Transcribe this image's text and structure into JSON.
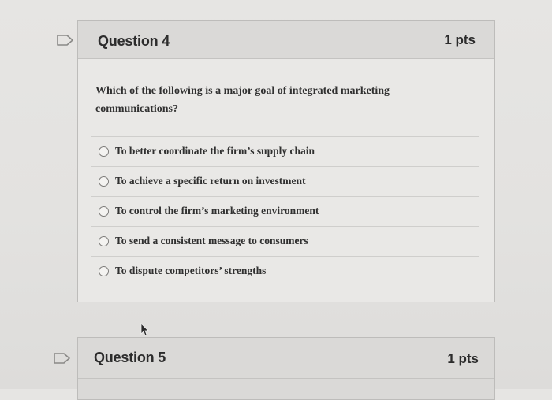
{
  "questions": [
    {
      "title": "Question 4",
      "points": "1 pts",
      "text": "Which of the following is a major goal of integrated marketing communications?",
      "answers": [
        {
          "label": "To better coordinate the firm’s supply chain"
        },
        {
          "label": "To achieve a specific return on investment"
        },
        {
          "label": "To control the firm’s marketing environment"
        },
        {
          "label": "To send a consistent message to consumers"
        },
        {
          "label": "To dispute competitors’ strengths"
        }
      ]
    },
    {
      "title": "Question 5",
      "points": "1 pts"
    }
  ],
  "icons": {
    "flag": "flag-icon",
    "cursor": "cursor-icon",
    "radio": "radio-button"
  },
  "colors": {
    "page_background": "#e4e3e1",
    "header_background": "#dad9d7",
    "card_border": "#bdbcba",
    "text": "#2d2d2d"
  }
}
